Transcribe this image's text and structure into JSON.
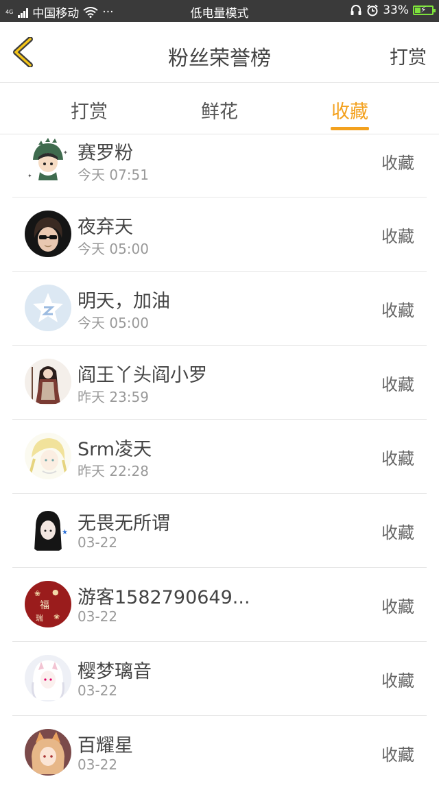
{
  "status_bar": {
    "network": "4G",
    "carrier": "中国移动",
    "dots": "···",
    "mode": "低电量模式",
    "battery_percent": "33%",
    "battery_level": 0.33,
    "icons": [
      "signal-icon",
      "wifi-icon",
      "headset-icon",
      "alarm-icon",
      "battery-icon"
    ]
  },
  "header": {
    "back_icon": "chevron-left-icon",
    "title": "粉丝荣誉榜",
    "right_action": "打赏"
  },
  "tabs": [
    {
      "label": "打赏",
      "active": false
    },
    {
      "label": "鲜花",
      "active": false
    },
    {
      "label": "收藏",
      "active": true
    }
  ],
  "colors": {
    "accent": "#f3a11e",
    "status_bar": "#3a3a3a",
    "battery": "#7ee23c"
  },
  "fans": [
    {
      "name": "赛罗粉",
      "time": "今天 07:51",
      "action": "收藏",
      "avatar": "dinosaur-hood-avatar"
    },
    {
      "name": "夜弃天",
      "time": "今天 05:00",
      "action": "收藏",
      "avatar": "sunglasses-boy-avatar"
    },
    {
      "name": "明天，加油",
      "time": "今天 05:00",
      "action": "收藏",
      "avatar": "default-star-avatar"
    },
    {
      "name": "阎王丫头阎小罗",
      "time": "昨天 23:59",
      "action": "收藏",
      "avatar": "robed-girl-avatar"
    },
    {
      "name": "Srm凌天",
      "time": "昨天 22:28",
      "action": "收藏",
      "avatar": "blonde-anime-avatar"
    },
    {
      "name": "无畏无所谓",
      "time": "03-22",
      "action": "收藏",
      "avatar": "dark-hair-avatar"
    },
    {
      "name": "游客1582790649...",
      "time": "03-22",
      "action": "收藏",
      "avatar": "red-calligraphy-avatar"
    },
    {
      "name": "樱梦璃音",
      "time": "03-22",
      "action": "收藏",
      "avatar": "white-hair-anime-avatar"
    },
    {
      "name": "百耀星",
      "time": "03-22",
      "action": "收藏",
      "avatar": "fox-anime-avatar"
    }
  ]
}
